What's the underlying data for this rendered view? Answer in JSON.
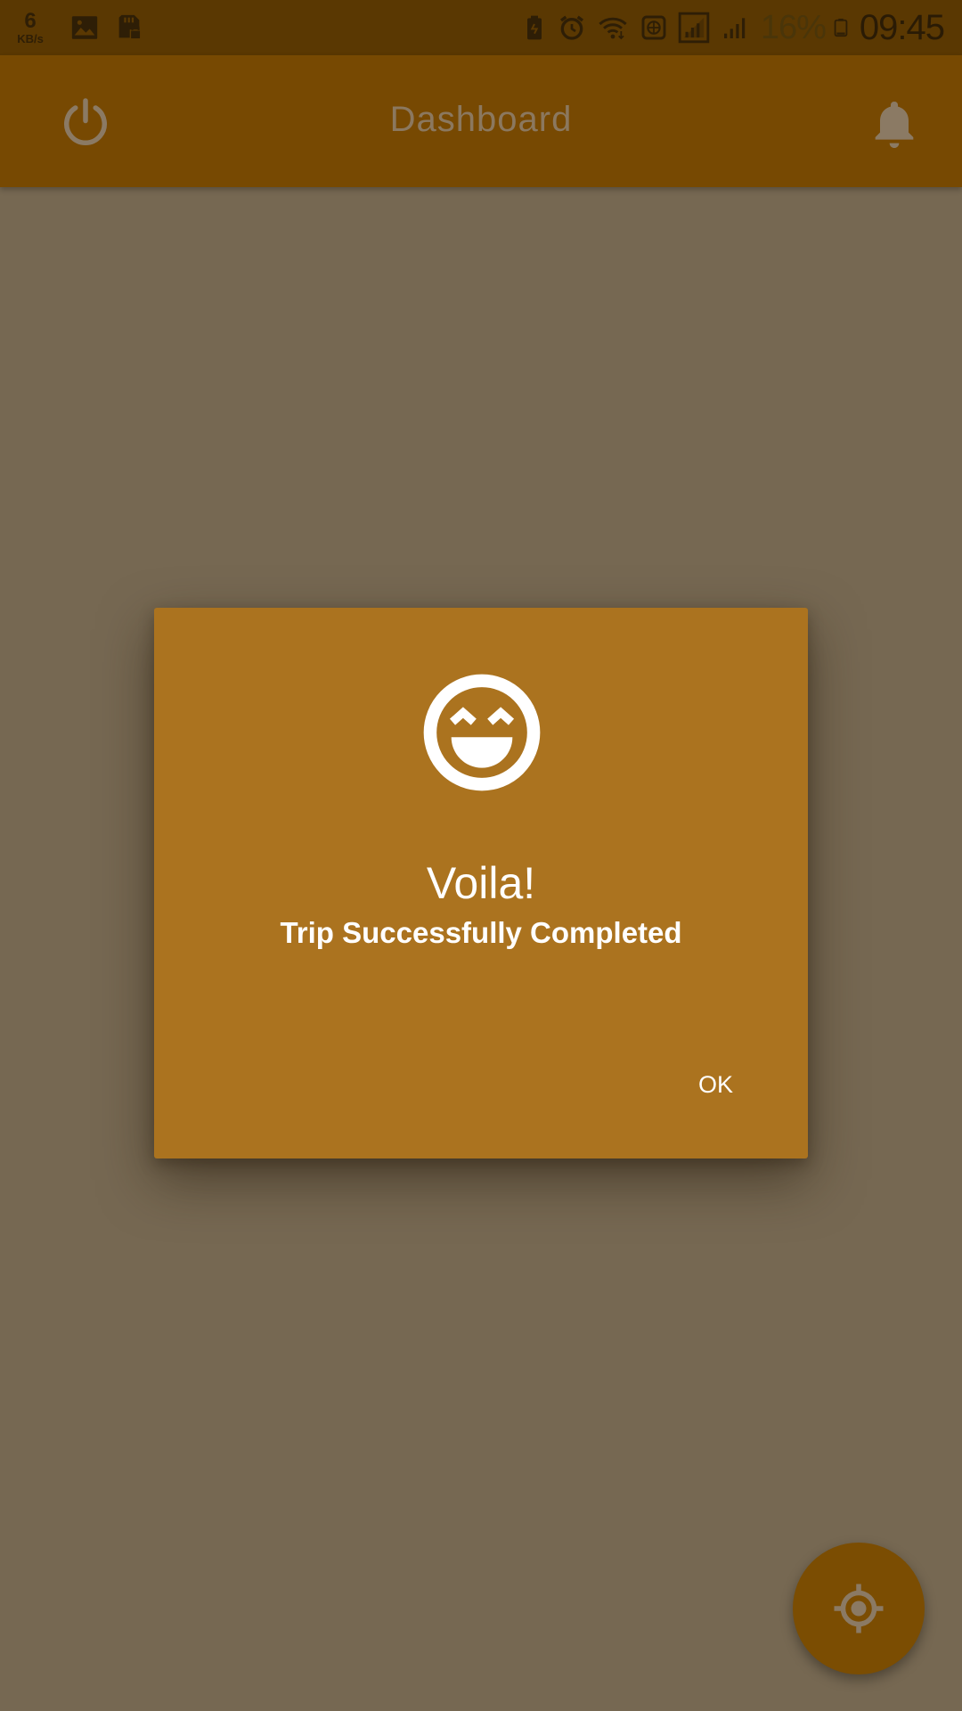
{
  "status_bar": {
    "network_speed_value": "6",
    "network_speed_unit": "KB/s",
    "battery_percent": "16%",
    "time": "09:45",
    "left_icons": [
      "image-icon",
      "sd-card-lock-icon"
    ],
    "right_icons": [
      "battery-saver-icon",
      "alarm-icon",
      "wifi-icon",
      "vpn-icon",
      "signal-sim1-icon",
      "signal-sim2-icon",
      "battery-icon"
    ]
  },
  "app_bar": {
    "title": "Dashboard",
    "left_icon": "power-icon",
    "right_icon": "bell-icon"
  },
  "dialog": {
    "icon": "grinning-face-icon",
    "title": "Voila!",
    "message": "Trip Successfully Completed",
    "ok_label": "OK"
  },
  "fab": {
    "icon": "my-location-icon"
  },
  "colors": {
    "status_bar": "#5a3802",
    "app_bar": "#774902",
    "scrim_background": "#766852",
    "dialog_background": "#ab731f",
    "dialog_text": "#ffffff",
    "fab_background": "#7b4d02",
    "muted_icon": "#8b7a64"
  }
}
